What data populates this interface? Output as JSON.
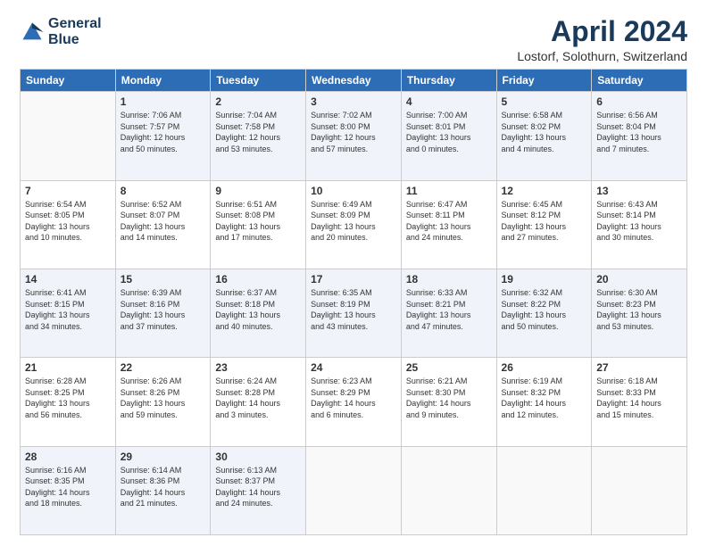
{
  "logo": {
    "line1": "General",
    "line2": "Blue"
  },
  "title": "April 2024",
  "subtitle": "Lostorf, Solothurn, Switzerland",
  "days_of_week": [
    "Sunday",
    "Monday",
    "Tuesday",
    "Wednesday",
    "Thursday",
    "Friday",
    "Saturday"
  ],
  "weeks": [
    [
      {
        "num": "",
        "info": ""
      },
      {
        "num": "1",
        "info": "Sunrise: 7:06 AM\nSunset: 7:57 PM\nDaylight: 12 hours\nand 50 minutes."
      },
      {
        "num": "2",
        "info": "Sunrise: 7:04 AM\nSunset: 7:58 PM\nDaylight: 12 hours\nand 53 minutes."
      },
      {
        "num": "3",
        "info": "Sunrise: 7:02 AM\nSunset: 8:00 PM\nDaylight: 12 hours\nand 57 minutes."
      },
      {
        "num": "4",
        "info": "Sunrise: 7:00 AM\nSunset: 8:01 PM\nDaylight: 13 hours\nand 0 minutes."
      },
      {
        "num": "5",
        "info": "Sunrise: 6:58 AM\nSunset: 8:02 PM\nDaylight: 13 hours\nand 4 minutes."
      },
      {
        "num": "6",
        "info": "Sunrise: 6:56 AM\nSunset: 8:04 PM\nDaylight: 13 hours\nand 7 minutes."
      }
    ],
    [
      {
        "num": "7",
        "info": "Sunrise: 6:54 AM\nSunset: 8:05 PM\nDaylight: 13 hours\nand 10 minutes."
      },
      {
        "num": "8",
        "info": "Sunrise: 6:52 AM\nSunset: 8:07 PM\nDaylight: 13 hours\nand 14 minutes."
      },
      {
        "num": "9",
        "info": "Sunrise: 6:51 AM\nSunset: 8:08 PM\nDaylight: 13 hours\nand 17 minutes."
      },
      {
        "num": "10",
        "info": "Sunrise: 6:49 AM\nSunset: 8:09 PM\nDaylight: 13 hours\nand 20 minutes."
      },
      {
        "num": "11",
        "info": "Sunrise: 6:47 AM\nSunset: 8:11 PM\nDaylight: 13 hours\nand 24 minutes."
      },
      {
        "num": "12",
        "info": "Sunrise: 6:45 AM\nSunset: 8:12 PM\nDaylight: 13 hours\nand 27 minutes."
      },
      {
        "num": "13",
        "info": "Sunrise: 6:43 AM\nSunset: 8:14 PM\nDaylight: 13 hours\nand 30 minutes."
      }
    ],
    [
      {
        "num": "14",
        "info": "Sunrise: 6:41 AM\nSunset: 8:15 PM\nDaylight: 13 hours\nand 34 minutes."
      },
      {
        "num": "15",
        "info": "Sunrise: 6:39 AM\nSunset: 8:16 PM\nDaylight: 13 hours\nand 37 minutes."
      },
      {
        "num": "16",
        "info": "Sunrise: 6:37 AM\nSunset: 8:18 PM\nDaylight: 13 hours\nand 40 minutes."
      },
      {
        "num": "17",
        "info": "Sunrise: 6:35 AM\nSunset: 8:19 PM\nDaylight: 13 hours\nand 43 minutes."
      },
      {
        "num": "18",
        "info": "Sunrise: 6:33 AM\nSunset: 8:21 PM\nDaylight: 13 hours\nand 47 minutes."
      },
      {
        "num": "19",
        "info": "Sunrise: 6:32 AM\nSunset: 8:22 PM\nDaylight: 13 hours\nand 50 minutes."
      },
      {
        "num": "20",
        "info": "Sunrise: 6:30 AM\nSunset: 8:23 PM\nDaylight: 13 hours\nand 53 minutes."
      }
    ],
    [
      {
        "num": "21",
        "info": "Sunrise: 6:28 AM\nSunset: 8:25 PM\nDaylight: 13 hours\nand 56 minutes."
      },
      {
        "num": "22",
        "info": "Sunrise: 6:26 AM\nSunset: 8:26 PM\nDaylight: 13 hours\nand 59 minutes."
      },
      {
        "num": "23",
        "info": "Sunrise: 6:24 AM\nSunset: 8:28 PM\nDaylight: 14 hours\nand 3 minutes."
      },
      {
        "num": "24",
        "info": "Sunrise: 6:23 AM\nSunset: 8:29 PM\nDaylight: 14 hours\nand 6 minutes."
      },
      {
        "num": "25",
        "info": "Sunrise: 6:21 AM\nSunset: 8:30 PM\nDaylight: 14 hours\nand 9 minutes."
      },
      {
        "num": "26",
        "info": "Sunrise: 6:19 AM\nSunset: 8:32 PM\nDaylight: 14 hours\nand 12 minutes."
      },
      {
        "num": "27",
        "info": "Sunrise: 6:18 AM\nSunset: 8:33 PM\nDaylight: 14 hours\nand 15 minutes."
      }
    ],
    [
      {
        "num": "28",
        "info": "Sunrise: 6:16 AM\nSunset: 8:35 PM\nDaylight: 14 hours\nand 18 minutes."
      },
      {
        "num": "29",
        "info": "Sunrise: 6:14 AM\nSunset: 8:36 PM\nDaylight: 14 hours\nand 21 minutes."
      },
      {
        "num": "30",
        "info": "Sunrise: 6:13 AM\nSunset: 8:37 PM\nDaylight: 14 hours\nand 24 minutes."
      },
      {
        "num": "",
        "info": ""
      },
      {
        "num": "",
        "info": ""
      },
      {
        "num": "",
        "info": ""
      },
      {
        "num": "",
        "info": ""
      }
    ]
  ]
}
